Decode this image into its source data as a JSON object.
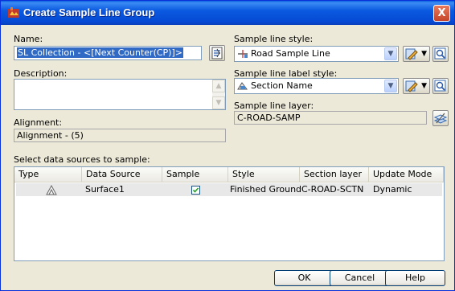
{
  "window": {
    "title": "Create Sample Line Group",
    "close_label": "X"
  },
  "name": {
    "label": "Name:",
    "value": "SL Collection - <[Next Counter(CP)]>"
  },
  "description": {
    "label": "Description:",
    "value": ""
  },
  "alignment": {
    "label": "Alignment:",
    "value": "Alignment - (5)"
  },
  "sample_line_style": {
    "label": "Sample line style:",
    "value": "Road Sample Line"
  },
  "sample_line_label_style": {
    "label": "Sample line label style:",
    "value": "Section Name"
  },
  "sample_line_layer": {
    "label": "Sample line layer:",
    "value": "C-ROAD-SAMP"
  },
  "data_sources": {
    "label": "Select data sources to sample:",
    "columns": [
      "Type",
      "Data Source",
      "Sample",
      "Style",
      "Section layer",
      "Update Mode"
    ],
    "rows": [
      {
        "type_icon": "surface-icon",
        "data_source": "Surface1",
        "sample": true,
        "style": "Finished Ground",
        "section_layer": "C-ROAD-SCTN",
        "update_mode": "Dynamic"
      }
    ]
  },
  "buttons": {
    "ok": "OK",
    "cancel": "Cancel",
    "help": "Help"
  },
  "colors": {
    "title_bar": "#0a5fe0",
    "dialog_bg": "#ece9d8",
    "selection": "#316ac5",
    "row_highlight": "#e8e8e8"
  }
}
